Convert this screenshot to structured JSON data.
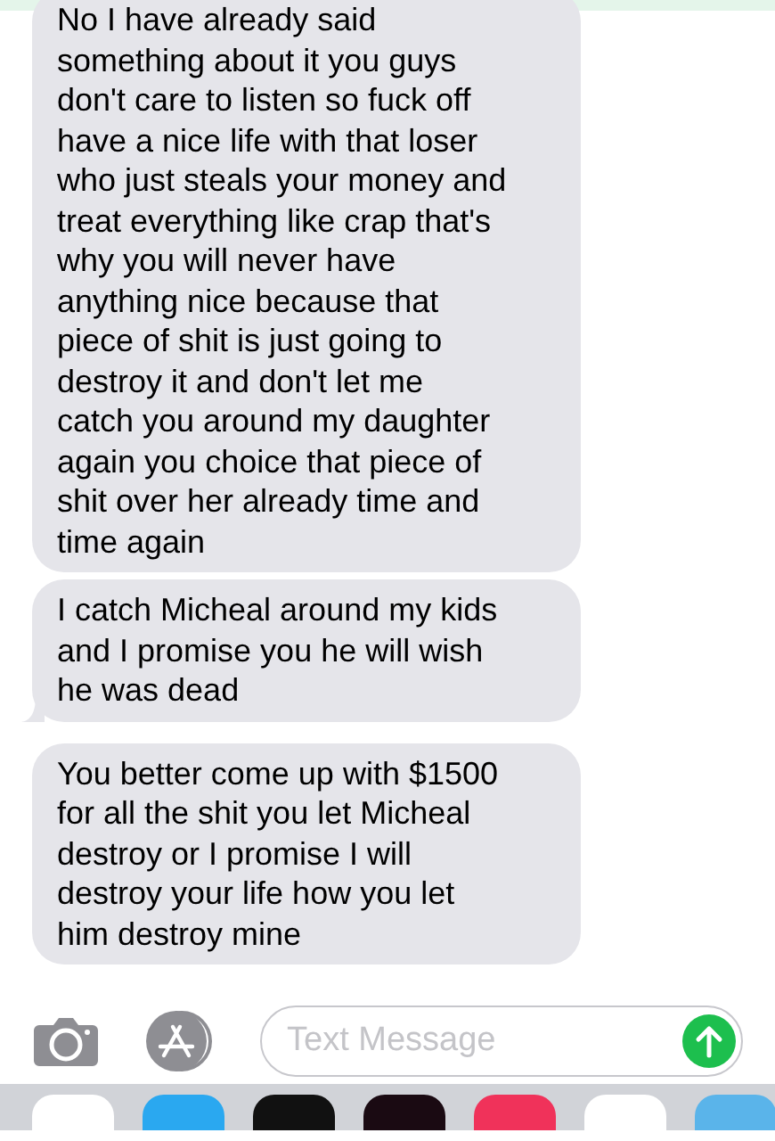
{
  "messages": [
    {
      "text": "No I have already said\nsomething about it you guys\ndon't care to listen so fuck off\nhave a nice life with that loser\nwho just steals your money and\ntreat everything like crap that's\nwhy you will never have\nanything nice because that\npiece of shit is just going to\ndestroy it and don't let me\ncatch you around my daughter\nagain you choice that piece of\nshit over her already time and\ntime again",
      "tail": false
    },
    {
      "text": "I catch Micheal around my kids\nand I promise you he will wish\nhe was dead",
      "tail": true
    },
    {
      "text": "You better come up with $1500\nfor all the shit you let Micheal\ndestroy or I promise I will\ndestroy your life how you let\nhim destroy mine",
      "tail": false
    }
  ],
  "composer": {
    "placeholder": "Text Message"
  }
}
